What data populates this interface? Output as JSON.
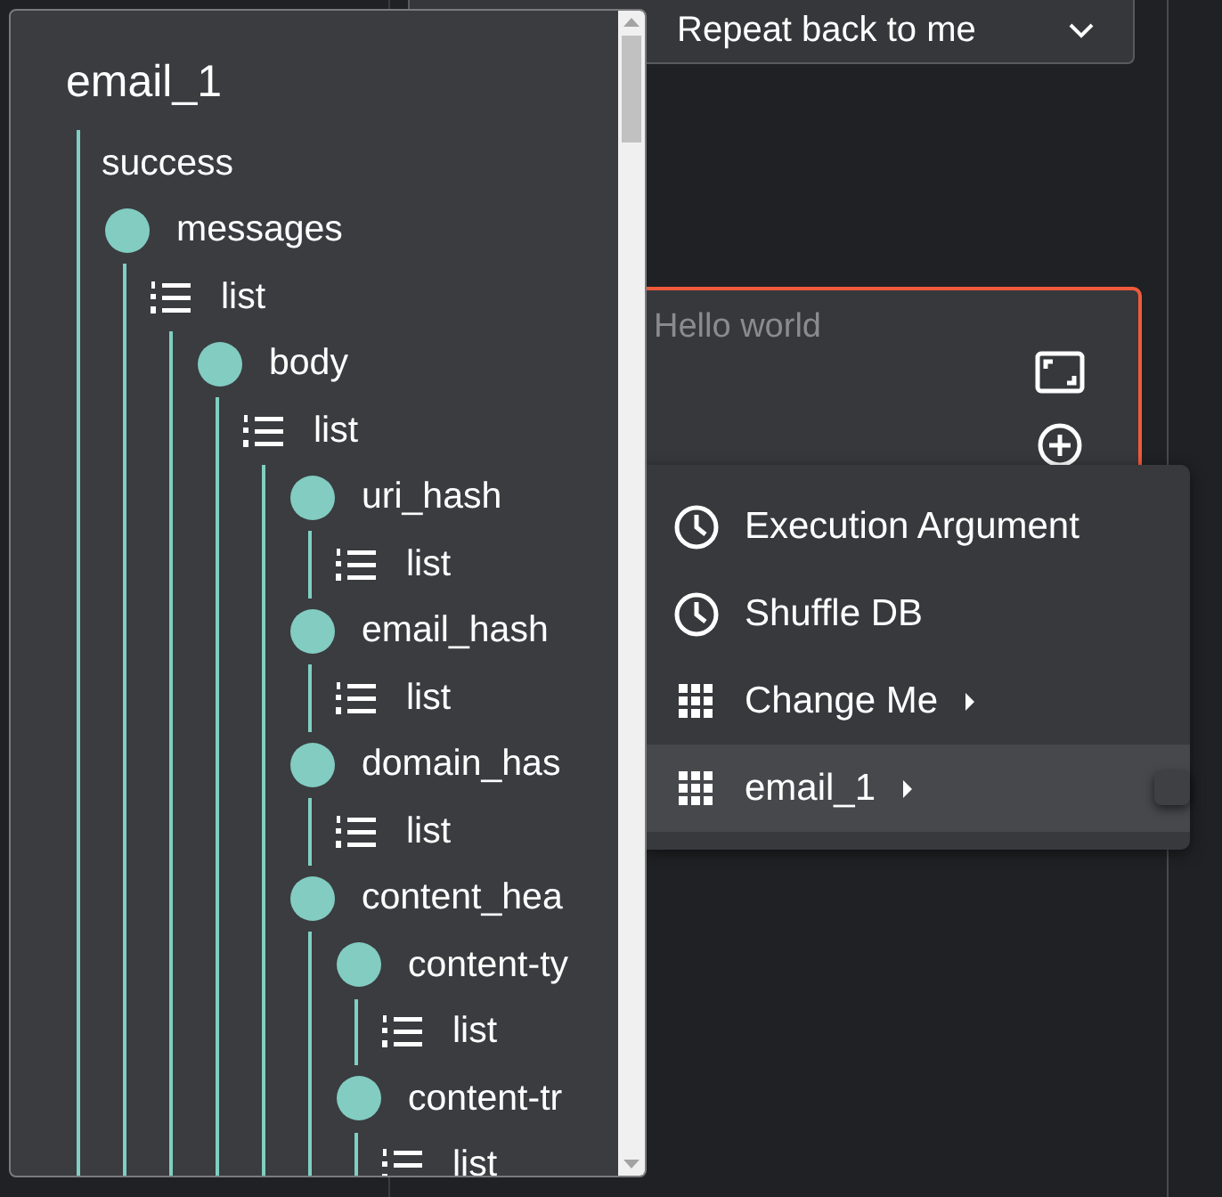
{
  "form": {
    "dropdown": {
      "value": "Repeat back to me"
    },
    "message_field": {
      "placeholder": "Hello world"
    }
  },
  "context_menu": {
    "items": [
      {
        "label": "Execution Argument",
        "kind": "clock",
        "has_submenu": false,
        "selected": false
      },
      {
        "label": "Shuffle DB",
        "kind": "clock",
        "has_submenu": false,
        "selected": false
      },
      {
        "label": "Change Me",
        "kind": "grid",
        "has_submenu": true,
        "selected": false
      },
      {
        "label": "email_1",
        "kind": "grid",
        "has_submenu": true,
        "selected": true
      }
    ]
  },
  "tree_popup": {
    "title": "email_1",
    "children": [
      {
        "label": "success",
        "kind": "value"
      },
      {
        "label": "messages",
        "kind": "object",
        "children": [
          {
            "label": "list",
            "kind": "list",
            "children": [
              {
                "label": "body",
                "kind": "object",
                "children": [
                  {
                    "label": "list",
                    "kind": "list",
                    "children": [
                      {
                        "label": "uri_hash",
                        "kind": "object",
                        "children": [
                          {
                            "label": "list",
                            "kind": "list"
                          }
                        ]
                      },
                      {
                        "label": "email_hash",
                        "kind": "object",
                        "children": [
                          {
                            "label": "list",
                            "kind": "list"
                          }
                        ]
                      },
                      {
                        "label": "domain_has",
                        "kind": "object",
                        "children": [
                          {
                            "label": "list",
                            "kind": "list"
                          }
                        ]
                      },
                      {
                        "label": "content_hea",
                        "kind": "object",
                        "children": [
                          {
                            "label": "content-ty",
                            "kind": "object",
                            "children": [
                              {
                                "label": "list",
                                "kind": "list"
                              }
                            ]
                          },
                          {
                            "label": "content-tr",
                            "kind": "object",
                            "children": [
                              {
                                "label": "list",
                                "kind": "list"
                              }
                            ]
                          }
                        ]
                      }
                    ]
                  }
                ]
              }
            ]
          }
        ]
      }
    ]
  }
}
